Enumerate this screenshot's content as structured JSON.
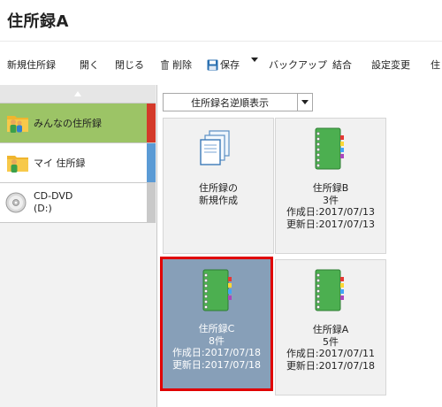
{
  "window": {
    "title": "住所録A"
  },
  "toolbar": {
    "new": "新規住所録",
    "open": "開く",
    "close": "閉じる",
    "delete": "削除",
    "save": "保存",
    "backup": "バックアップ",
    "merge": "結合",
    "settings": "設定変更",
    "more": "住"
  },
  "sidebar": {
    "items": [
      {
        "label": "みんなの住所録",
        "bar_color": "#d43a2a",
        "icon": "people-folder-icon"
      },
      {
        "label": "マイ 住所録",
        "bar_color": "#5b9bd5",
        "icon": "person-folder-icon"
      },
      {
        "label": "CD-DVD",
        "label2": "(D:)",
        "bar_color": "#c9c9c9",
        "icon": "disc-icon"
      }
    ]
  },
  "main": {
    "sort": {
      "label": "住所録名逆順表示"
    },
    "cards": [
      {
        "line1": "住所録の",
        "line2": "新規作成"
      },
      {
        "name": "住所録B",
        "count": "3件",
        "created": "作成日:2017/07/13",
        "updated": "更新日:2017/07/13"
      },
      {
        "name": "住所録C",
        "count": "8件",
        "created": "作成日:2017/07/18",
        "updated": "更新日:2017/07/18"
      },
      {
        "name": "住所録A",
        "count": "5件",
        "created": "作成日:2017/07/11",
        "updated": "更新日:2017/07/18"
      }
    ]
  },
  "colors": {
    "active_bg": "#9cc466",
    "selected_bg": "#879fb8",
    "selected_border": "#e00000",
    "book_green": "#4caf50"
  }
}
